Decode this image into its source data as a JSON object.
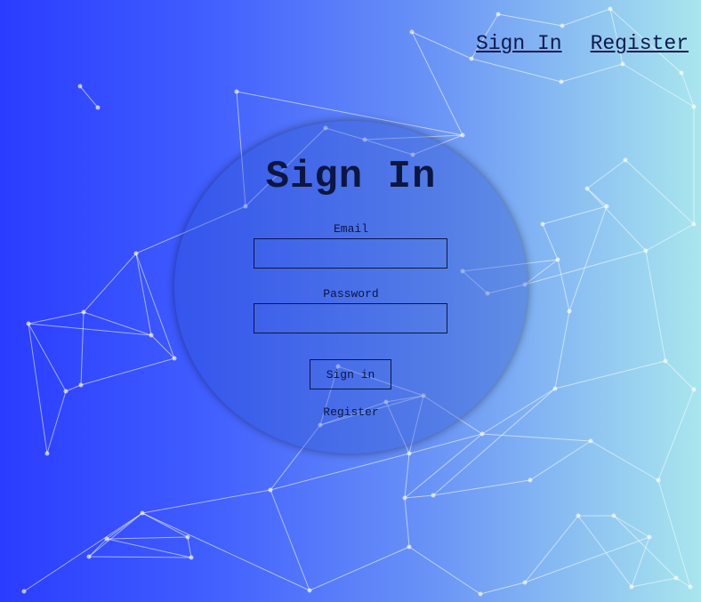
{
  "nav": {
    "sign_in": "Sign In",
    "register": "Register"
  },
  "form": {
    "title": "Sign In",
    "email_label": "Email",
    "email_value": "",
    "password_label": "Password",
    "password_value": "",
    "submit_label": "Sign in",
    "register_label": "Register"
  }
}
